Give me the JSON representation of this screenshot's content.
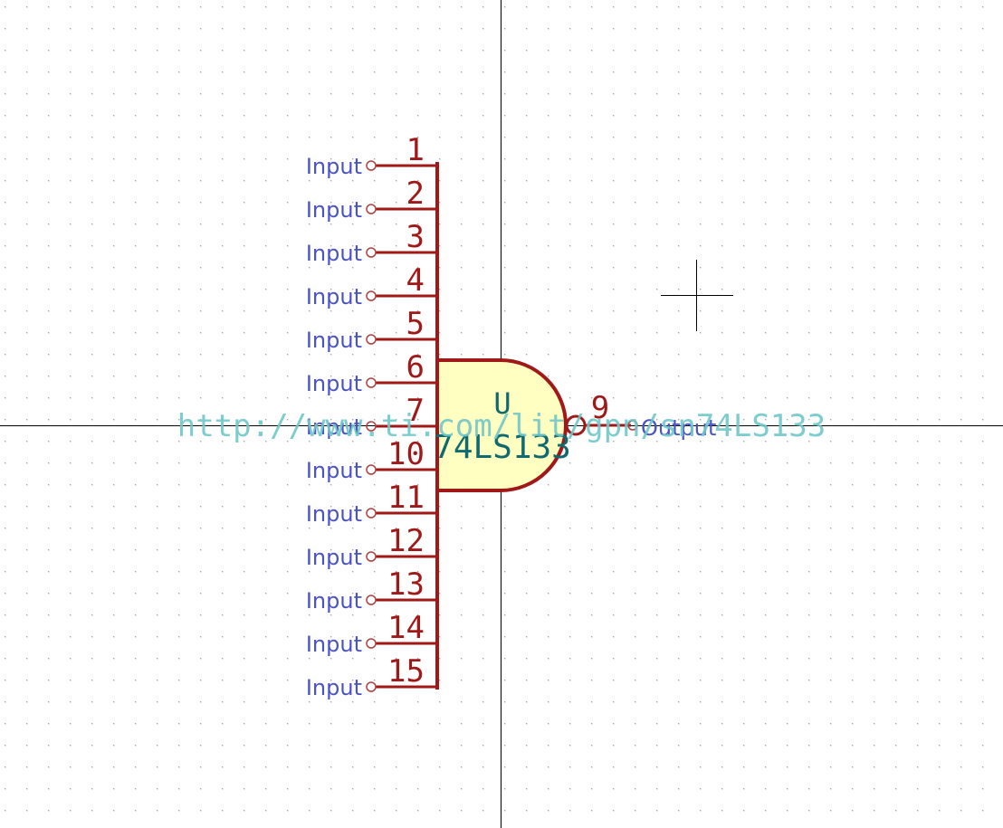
{
  "symbol": {
    "reference": "U",
    "value": "74LS133",
    "datasheet": "http://www.ti.com/lit/gpn/sn74LS133",
    "input_pins": [
      {
        "number": "1",
        "type": "Input"
      },
      {
        "number": "2",
        "type": "Input"
      },
      {
        "number": "3",
        "type": "Input"
      },
      {
        "number": "4",
        "type": "Input"
      },
      {
        "number": "5",
        "type": "Input"
      },
      {
        "number": "6",
        "type": "Input"
      },
      {
        "number": "7",
        "type": "Input"
      },
      {
        "number": "10",
        "type": "Input"
      },
      {
        "number": "11",
        "type": "Input"
      },
      {
        "number": "12",
        "type": "Input"
      },
      {
        "number": "13",
        "type": "Input"
      },
      {
        "number": "14",
        "type": "Input"
      },
      {
        "number": "15",
        "type": "Input"
      }
    ],
    "output_pin": {
      "number": "9",
      "type": "Output"
    }
  },
  "colors": {
    "body_fill": "#ffffc2",
    "body_stroke": "#a01818",
    "pin_number": "#a01818",
    "pin_type": "#4a52c6",
    "field_text": "#0e6a6e",
    "datasheet_text": "#70c7c9",
    "axis": "#000000",
    "grid_dot": "#a8a8a8"
  }
}
